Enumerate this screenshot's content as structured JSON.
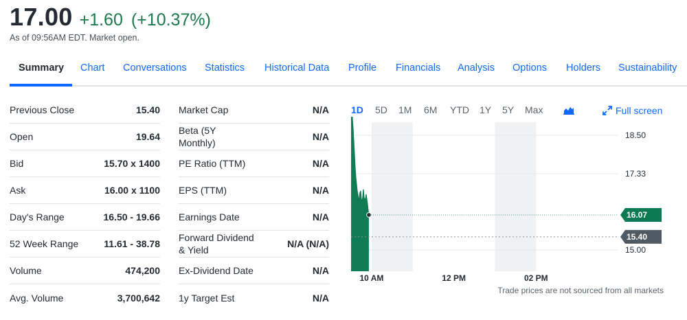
{
  "quote": {
    "price": "17.00",
    "change": "+1.60",
    "change_percent": "(+10.37%)",
    "as_of": "As of 09:56AM EDT. Market open.",
    "change_color": "#1b7a4c"
  },
  "tabs": [
    "Summary",
    "Chart",
    "Conversations",
    "Statistics",
    "Historical Data",
    "Profile",
    "Financials",
    "Analysis",
    "Options",
    "Holders",
    "Sustainability"
  ],
  "active_tab": "Summary",
  "stats_left": [
    {
      "label": "Previous Close",
      "value": "15.40"
    },
    {
      "label": "Open",
      "value": "19.64"
    },
    {
      "label": "Bid",
      "value": "15.70 x 1400"
    },
    {
      "label": "Ask",
      "value": "16.00 x 1100"
    },
    {
      "label": "Day's Range",
      "value": "16.50 - 19.66"
    },
    {
      "label": "52 Week Range",
      "value": "11.61 - 38.78"
    },
    {
      "label": "Volume",
      "value": "474,200"
    },
    {
      "label": "Avg. Volume",
      "value": "3,700,642"
    }
  ],
  "stats_right": [
    {
      "label": "Market Cap",
      "value": "N/A"
    },
    {
      "label": "Beta (5Y Monthly)",
      "value": "N/A"
    },
    {
      "label": "PE Ratio (TTM)",
      "value": "N/A"
    },
    {
      "label": "EPS (TTM)",
      "value": "N/A"
    },
    {
      "label": "Earnings Date",
      "value": "N/A"
    },
    {
      "label": "Forward Dividend & Yield",
      "value": "N/A (N/A)"
    },
    {
      "label": "Ex-Dividend Date",
      "value": "N/A"
    },
    {
      "label": "1y Target Est",
      "value": "N/A"
    }
  ],
  "chart": {
    "ranges": [
      "1D",
      "5D",
      "1M",
      "6M",
      "YTD",
      "1Y",
      "5Y",
      "Max"
    ],
    "active_range": "1D",
    "fullscreen_label": "Full screen",
    "chart_type_icon": "area-chart-icon",
    "fullscreen_icon": "expand-arrows-icon",
    "y_ticks": [
      "18.50",
      "17.33",
      "15.00"
    ],
    "x_ticks": [
      "10 AM",
      "12 PM",
      "02 PM"
    ],
    "current_price_label": "16.07",
    "previous_close_label": "15.40",
    "disclaimer": "Trade prices are not sourced from all markets",
    "colors": {
      "line": "#0b7a52",
      "area": "#0f7c55",
      "price_tag": "#0b7a52",
      "prev_close_tag": "#505a62",
      "shaded": "#eff1f3"
    }
  },
  "chart_data": {
    "type": "area",
    "x_unit": "time of day",
    "x": [
      "09:30",
      "09:31",
      "09:32",
      "09:33",
      "09:34",
      "09:35",
      "09:36",
      "09:37",
      "09:38",
      "09:39",
      "09:40",
      "09:41",
      "09:42",
      "09:43",
      "09:44",
      "09:45",
      "09:46",
      "09:47",
      "09:48",
      "09:49",
      "09:50",
      "09:51",
      "09:52",
      "09:53",
      "09:54",
      "09:55",
      "09:56"
    ],
    "y": [
      19.6,
      19.3,
      19.0,
      18.7,
      18.3,
      17.9,
      17.5,
      17.2,
      17.0,
      16.8,
      16.7,
      16.5,
      16.6,
      16.75,
      16.8,
      16.55,
      16.5,
      16.6,
      16.85,
      16.6,
      16.55,
      16.55,
      16.7,
      16.55,
      16.4,
      16.2,
      16.07
    ],
    "ylim": [
      14.35,
      18.9
    ],
    "y_ticks": [
      18.5,
      17.33,
      15.0
    ],
    "x_ticks": [
      "10 AM",
      "12 PM",
      "02 PM"
    ],
    "current_price": 16.07,
    "previous_close": 15.4
  }
}
